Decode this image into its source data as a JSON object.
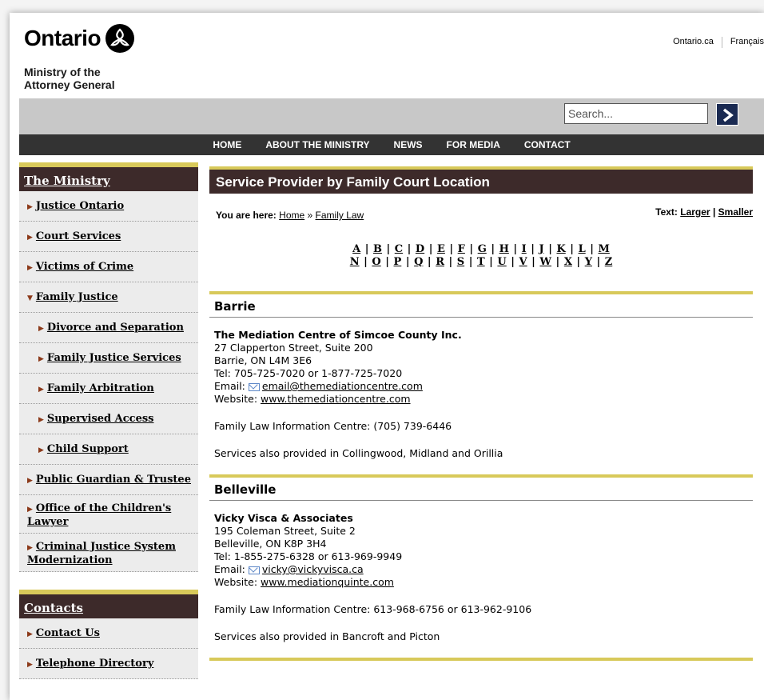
{
  "header": {
    "logo_text": "Ontario",
    "ministry_line1": "Ministry of the",
    "ministry_line2": "Attorney General",
    "toplinks": [
      "Ontario.ca",
      "Français"
    ]
  },
  "search": {
    "placeholder": "Search..."
  },
  "nav": [
    "HOME",
    "ABOUT THE MINISTRY",
    "NEWS",
    "FOR MEDIA",
    "CONTACT"
  ],
  "sidebar": {
    "ministry_title": "The Ministry",
    "items": [
      {
        "label": "Justice Ontario",
        "sub": false
      },
      {
        "label": "Court Services",
        "sub": false
      },
      {
        "label": "Victims of Crime",
        "sub": false
      },
      {
        "label": "Family Justice",
        "sub": false,
        "expanded": true
      },
      {
        "label": "Divorce and Separation",
        "sub": true
      },
      {
        "label": "Family Justice Services",
        "sub": true
      },
      {
        "label": "Family Arbitration",
        "sub": true
      },
      {
        "label": "Supervised Access",
        "sub": true
      },
      {
        "label": "Child Support",
        "sub": true
      },
      {
        "label": "Public Guardian & Trustee",
        "sub": false
      },
      {
        "label": "Office of the Children's Lawyer",
        "sub": false,
        "tall": true
      },
      {
        "label": "Criminal Justice System Modernization",
        "sub": false,
        "tall": true
      }
    ],
    "contacts_title": "Contacts",
    "contacts": [
      "Contact Us",
      "Telephone Directory"
    ]
  },
  "content": {
    "title": "Service Provider by Family Court Location",
    "breadcrumb_prefix": "You are here:",
    "breadcrumb": [
      "Home",
      "Family Law"
    ],
    "breadcrumb_sep": "»",
    "text_label": "Text:",
    "text_larger": "Larger",
    "text_smaller": "Smaller",
    "alpha_row1": [
      "A",
      "B",
      "C",
      "D",
      "E",
      "F",
      "G",
      "H",
      "I",
      "J",
      "K",
      "L",
      "M"
    ],
    "alpha_row2": [
      "N",
      "O",
      "P",
      "Q",
      "R",
      "S",
      "T",
      "U",
      "V",
      "W",
      "X",
      "Y",
      "Z"
    ],
    "sections": [
      {
        "city": "Barrie",
        "org": "The Mediation Centre of Simcoe County Inc.",
        "address1": "27 Clapperton Street, Suite 200",
        "address2": "Barrie, ON L4M 3E6",
        "tel": "Tel: 705-725-7020 or 1-877-725-7020",
        "email_label": "Email:",
        "email": "email@themediationcentre.com",
        "website_label": "Website:",
        "website": "www.themediationcentre.com",
        "flic": "Family Law Information Centre: (705) 739-6446",
        "also": "Services also provided in Collingwood, Midland and Orillia"
      },
      {
        "city": "Belleville",
        "org": "Vicky Visca & Associates",
        "address1": "195 Coleman Street, Suite 2",
        "address2": "Belleville, ON K8P 3H4",
        "tel": "Tel: 1-855-275-6328 or 613-969-9949",
        "email_label": "Email:",
        "email": "vicky@vickyvisca.ca",
        "website_label": "Website:",
        "website": "www.mediationquinte.com",
        "flic": "Family Law Information Centre: 613-968-6756 or 613-962-9106",
        "also": "Services also provided in Bancroft and Picton"
      }
    ]
  }
}
